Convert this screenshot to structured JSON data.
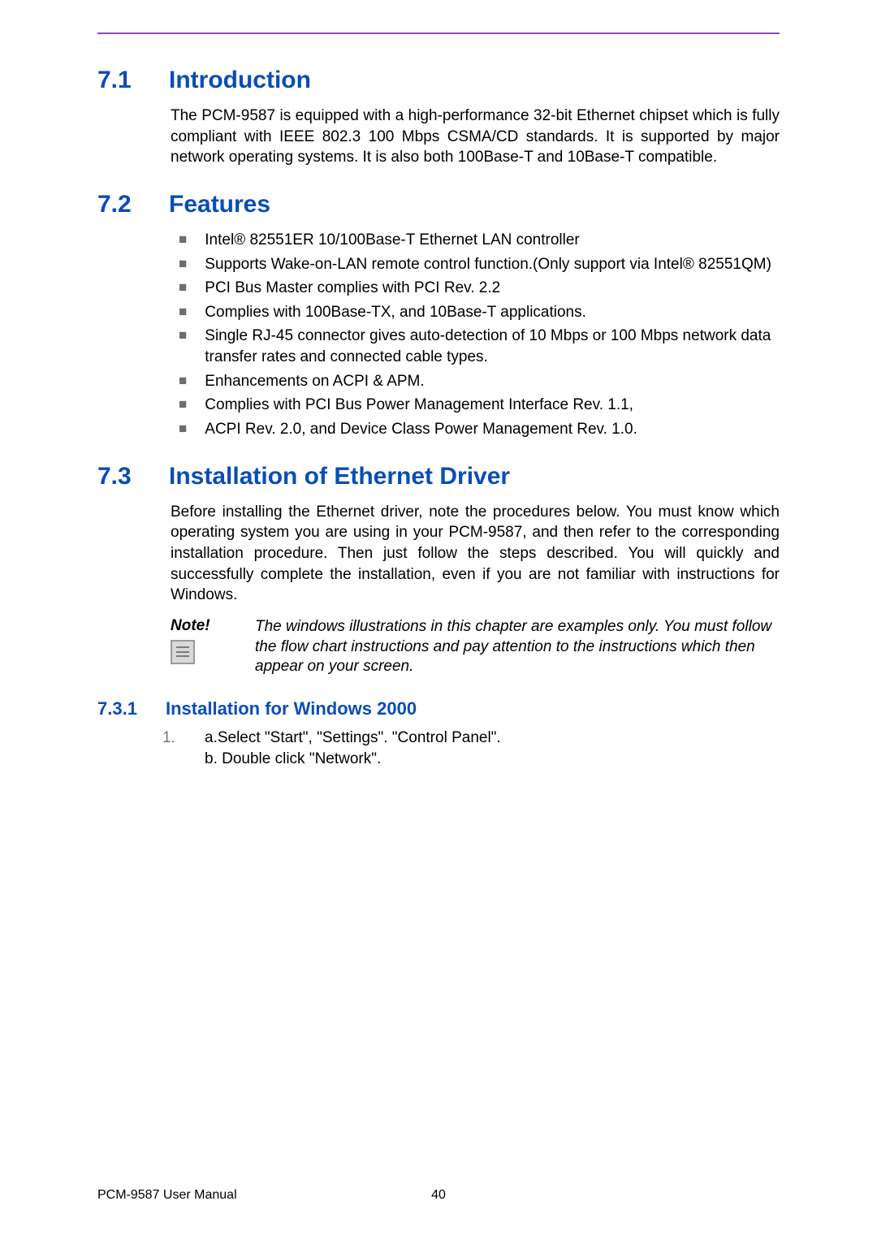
{
  "sections": {
    "s1": {
      "num": "7.1",
      "title": "Introduction",
      "body": "The PCM-9587 is equipped with a high-performance 32-bit Ethernet chipset which is fully compliant with IEEE 802.3 100 Mbps CSMA/CD standards. It is supported by major network operating systems. It is also both 100Base-T and 10Base-T compatible."
    },
    "s2": {
      "num": "7.2",
      "title": "Features",
      "bullets": [
        "Intel®  82551ER 10/100Base-T Ethernet LAN controller",
        "Supports Wake-on-LAN remote control function.(Only support via Intel® 82551QM)",
        "PCI Bus Master complies with PCI Rev. 2.2",
        "Complies with 100Base-TX, and 10Base-T applications.",
        "Single RJ-45 connector gives auto-detection of 10 Mbps or 100 Mbps network data transfer rates and connected cable types.",
        "Enhancements on ACPI & APM.",
        "Complies with PCI Bus Power Management Interface Rev. 1.1,",
        "ACPI Rev. 2.0, and Device Class Power Management Rev. 1.0."
      ]
    },
    "s3": {
      "num": "7.3",
      "title": "Installation of Ethernet Driver",
      "body": "Before installing the Ethernet driver, note the procedures below. You must know which operating system you are using in your PCM-9587, and then refer to the corresponding installation procedure. Then just follow the steps described. You will quickly and successfully complete the installation, even if you are not familiar with instructions for Windows.",
      "note_label": "Note!",
      "note_text": "The windows illustrations in this chapter are examples only. You must follow the flow chart instructions and pay attention to the instructions which then appear on your screen.",
      "sub": {
        "num": "7.3.1",
        "title": "Installation for Windows 2000",
        "step_num": "1.",
        "step_a": "a.Select \"Start\", \"Settings\". \"Control Panel\".",
        "step_b": "b. Double click \"Network\"."
      }
    }
  },
  "footer": {
    "title": "PCM-9587 User Manual",
    "page": "40"
  }
}
